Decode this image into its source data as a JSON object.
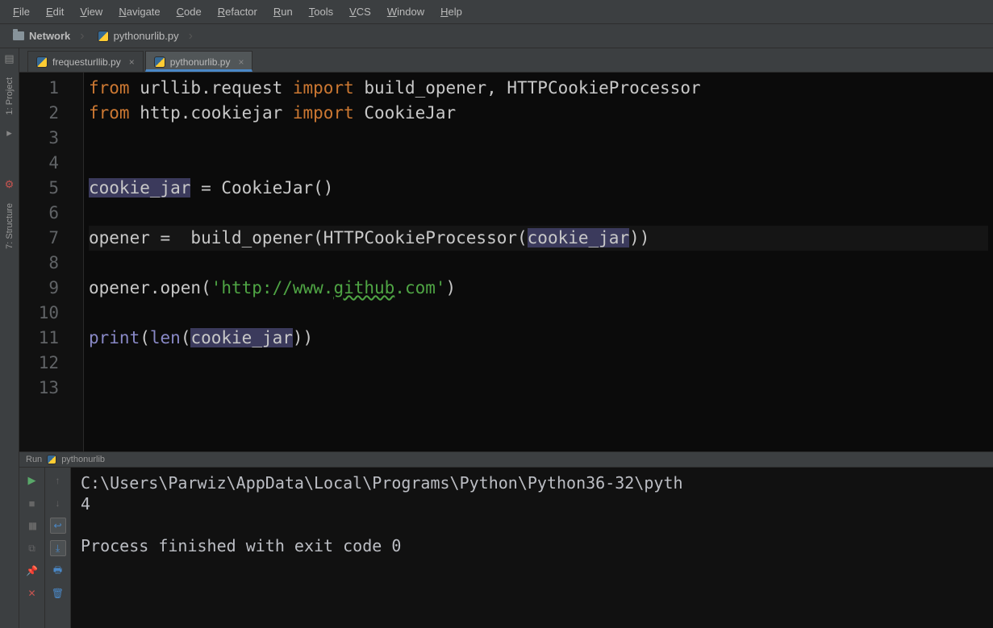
{
  "menu": [
    "File",
    "Edit",
    "View",
    "Navigate",
    "Code",
    "Refactor",
    "Run",
    "Tools",
    "VCS",
    "Window",
    "Help"
  ],
  "breadcrumb": {
    "root": "Network",
    "file": "pythonurlib.py"
  },
  "tabs": [
    {
      "label": "frequesturllib.py",
      "active": false
    },
    {
      "label": "pythonurlib.py",
      "active": true
    }
  ],
  "left_tools": [
    {
      "name": "project",
      "label": "1: Project"
    },
    {
      "name": "structure",
      "label": "7: Structure"
    }
  ],
  "code_lines": [
    {
      "n": 1,
      "html": "<span class='kw'>from</span> urllib.request <span class='kw'>import</span> build_opener, HTTPCookieProcessor"
    },
    {
      "n": 2,
      "html": "<span class='kw'>from</span> http.cookiejar <span class='kw'>import</span> CookieJar"
    },
    {
      "n": 3,
      "html": ""
    },
    {
      "n": 4,
      "html": ""
    },
    {
      "n": 5,
      "html": "<span class='hl'>cookie_jar</span> = CookieJar()"
    },
    {
      "n": 6,
      "html": ""
    },
    {
      "n": 7,
      "html": "opener =  build_opener(HTTPCookieProcessor(<span class='hl'>cookie_jar</span>))",
      "active": true
    },
    {
      "n": 8,
      "html": ""
    },
    {
      "n": 9,
      "html": "opener.open(<span class='str'>'http://www.</span><span class='link'>github</span><span class='str'>.com'</span>)"
    },
    {
      "n": 10,
      "html": ""
    },
    {
      "n": 11,
      "html": "<span class='builtin'>print</span>(<span class='builtin'>len</span>(<span class='hl'>cookie_jar</span>))"
    },
    {
      "n": 12,
      "html": ""
    },
    {
      "n": 13,
      "html": ""
    }
  ],
  "run": {
    "header": "Run",
    "config": "pythonurlib",
    "output": "C:\\Users\\Parwiz\\AppData\\Local\\Programs\\Python\\Python36-32\\pyth\n4\n\nProcess finished with exit code 0"
  }
}
